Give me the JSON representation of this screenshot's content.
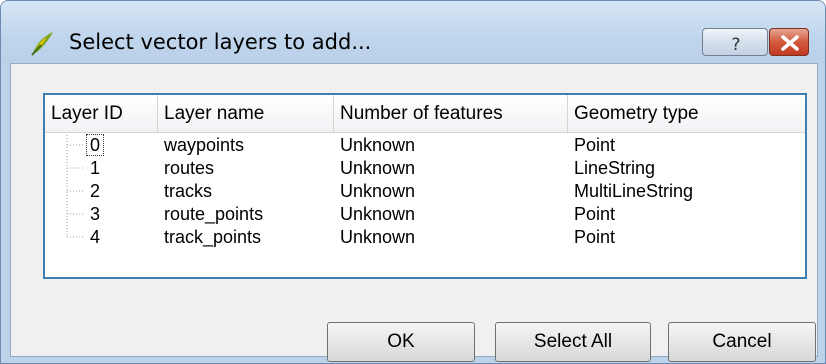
{
  "window": {
    "title": "Select vector layers to add...",
    "help_label": "?",
    "close_label": "✕"
  },
  "table": {
    "columns": [
      "Layer ID",
      "Layer name",
      "Number of features",
      "Geometry type"
    ],
    "rows": [
      {
        "id": "0",
        "name": "waypoints",
        "features": "Unknown",
        "geometry": "Point"
      },
      {
        "id": "1",
        "name": "routes",
        "features": "Unknown",
        "geometry": "LineString"
      },
      {
        "id": "2",
        "name": "tracks",
        "features": "Unknown",
        "geometry": "MultiLineString"
      },
      {
        "id": "3",
        "name": "route_points",
        "features": "Unknown",
        "geometry": "Point"
      },
      {
        "id": "4",
        "name": "track_points",
        "features": "Unknown",
        "geometry": "Point"
      }
    ]
  },
  "buttons": {
    "ok": "OK",
    "select_all": "Select All",
    "cancel": "Cancel"
  },
  "icons": {
    "app": "qgis-logo-icon",
    "help": "question-mark-icon",
    "close": "close-icon"
  },
  "colors": {
    "accent_border": "#3c7fb1",
    "close_button": "#c13a20"
  }
}
